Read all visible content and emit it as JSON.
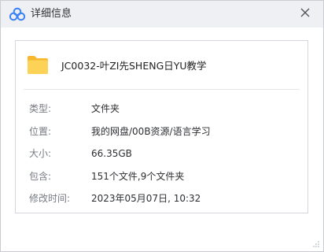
{
  "window": {
    "title": "详细信息",
    "icon": "app-logo-icon",
    "close_icon": "close-icon"
  },
  "file": {
    "icon": "folder-icon",
    "name": "JC0032-叶ZI先SHENG日YU教学"
  },
  "properties": [
    {
      "label": "类型:",
      "value": "文件夹"
    },
    {
      "label": "位置:",
      "value": "我的网盘/00B资源/语言学习"
    },
    {
      "label": "大小:",
      "value": "66.35GB"
    },
    {
      "label": "包含:",
      "value": "151个文件,9个文件夹"
    },
    {
      "label": "修改时间:",
      "value": "2023年05月07日, 10:32"
    }
  ],
  "colors": {
    "titlebar_bg": "#eef0f4",
    "logo_blue": "#3b82f6",
    "folder_yellow": "#f7c948"
  }
}
